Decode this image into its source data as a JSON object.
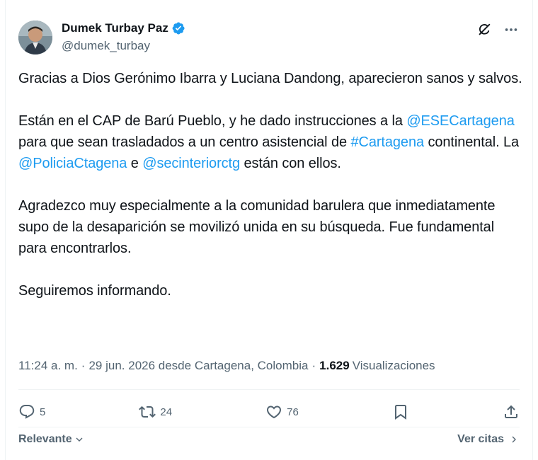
{
  "author": {
    "name": "Dumek Turbay Paz",
    "handle": "@dumek_turbay",
    "verified": true,
    "verified_color": "#1d9bf0"
  },
  "tweet": {
    "p1": "Gracias a Dios Gerónimo Ibarra y Luciana Dandong, aparecieron sanos y salvos.",
    "p2_a": "Están en el CAP de Barú Pueblo, y he dado instrucciones a la ",
    "p2_link1": "@ESECartagena",
    "p2_b": " para que sean trasladados a un centro asistencial de ",
    "p2_link2": "#Cartagena",
    "p2_c": " continental. La ",
    "p2_link3": "@PoliciaCtagena",
    "p2_d": " e ",
    "p2_link4": "@secinteriorctg",
    "p2_e": " están con ellos.",
    "p3": "Agradezco muy especialmente a la comunidad barulera que inmediatamente supo de la desaparición se movilizó unida en su búsqueda. Fue fundamental para encontrarlos.",
    "p4": "Seguiremos informando."
  },
  "meta": {
    "time": "11:24 a. m.",
    "sep1": "·",
    "date_place": "29 jun. 2026 desde Cartagena, Colombia",
    "sep2": "·",
    "views_count": "1.629",
    "views_label": "Visualizaciones"
  },
  "actions": {
    "replies": "5",
    "reposts": "24",
    "likes": "76"
  },
  "footer": {
    "sort_label": "Relevante",
    "quotes_label": "Ver citas"
  },
  "colors": {
    "text": "#0f1419",
    "secondary": "#536471",
    "link": "#1d9bf0"
  }
}
